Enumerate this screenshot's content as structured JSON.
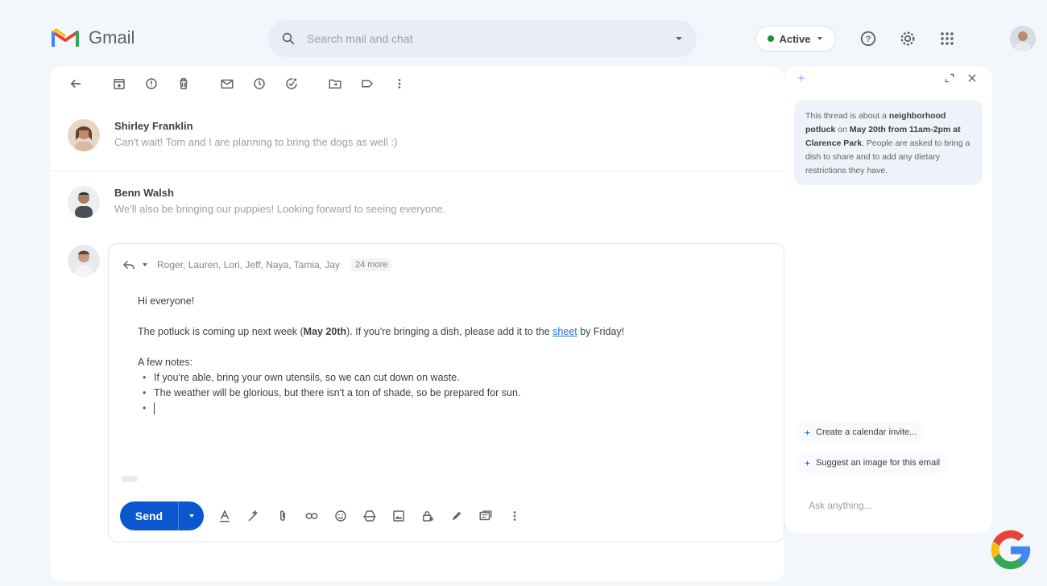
{
  "app": {
    "name": "Gmail"
  },
  "search": {
    "placeholder": "Search mail and chat"
  },
  "status": {
    "label": "Active",
    "color": "#1e8e3e"
  },
  "toolbar": {
    "icons": [
      "back-arrow-icon",
      "archive-icon",
      "report-spam-icon",
      "delete-icon",
      "mark-unread-icon",
      "snooze-icon",
      "add-task-icon",
      "move-to-icon",
      "label-icon",
      "more-icon"
    ]
  },
  "thread": {
    "messages": [
      {
        "sender": "Shirley Franklin",
        "snippet": "Can't wait! Tom and I are planning to bring the dogs as well :)"
      },
      {
        "sender": "Benn Walsh",
        "snippet": "We'll also be bringing our puppies! Looking forward to seeing everyone."
      }
    ]
  },
  "compose": {
    "recipients": "Roger, Lauren, Lori, Jeff, Naya, Tamia, Jay",
    "more": "24 more",
    "greeting": "Hi everyone!",
    "line1_pre": "The potluck is coming up next week (",
    "line1_bold": "May 20th",
    "line1_mid": "). If you're bringing a dish, please add it to the ",
    "line1_link": "sheet",
    "line1_post": " by Friday!",
    "notes_header": "A few notes:",
    "bullets": [
      "If you're able, bring your own utensils, so we can cut down on waste.",
      "The weather will be glorious, but there isn't a ton of shade, so be prepared for sun."
    ],
    "send_label": "Send"
  },
  "side_panel": {
    "summary_pre": "This thread is about a ",
    "summary_b1": "neighborhood potluck",
    "summary_mid1": " on ",
    "summary_b2": "May 20th from 11am-2pm at Clarence Park",
    "summary_post": ". People are asked to bring a dish to share and to add any dietary restrictions they have.",
    "chips": [
      "Create a calendar invite...",
      "Suggest an image for this email"
    ],
    "ask_placeholder": "Ask anything..."
  },
  "colors": {
    "accent": "#0b57d0",
    "background": "#f3f6fb"
  }
}
